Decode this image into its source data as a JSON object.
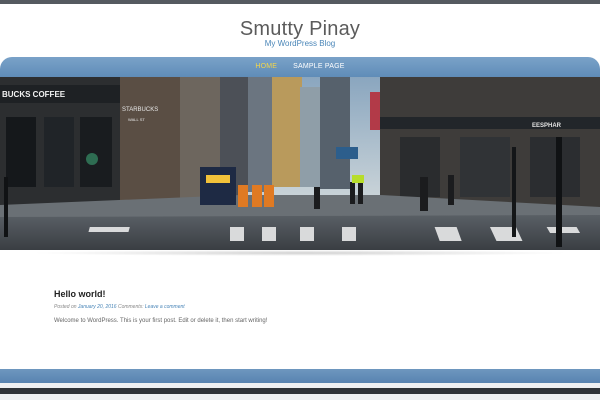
{
  "site": {
    "title": "Smutty Pinay",
    "description": "My WordPress Blog"
  },
  "nav": {
    "items": [
      {
        "label": "HOME",
        "active": true
      },
      {
        "label": "SAMPLE PAGE",
        "active": false
      }
    ]
  },
  "hero": {
    "signs": {
      "shop_left": "BUCKS COFFEE",
      "shop_mid": "STARBUCKS",
      "street_sign": "WALL ST",
      "shop_right": "EESPHAR"
    }
  },
  "post": {
    "title": "Hello world!",
    "meta": {
      "posted_on": "Posted on",
      "date": "January 20, 2016",
      "comments": "Comments:",
      "comments_link": "Leave a comment"
    },
    "content": "Welcome to WordPress. This is your first post. Edit or delete it, then start writing!"
  }
}
